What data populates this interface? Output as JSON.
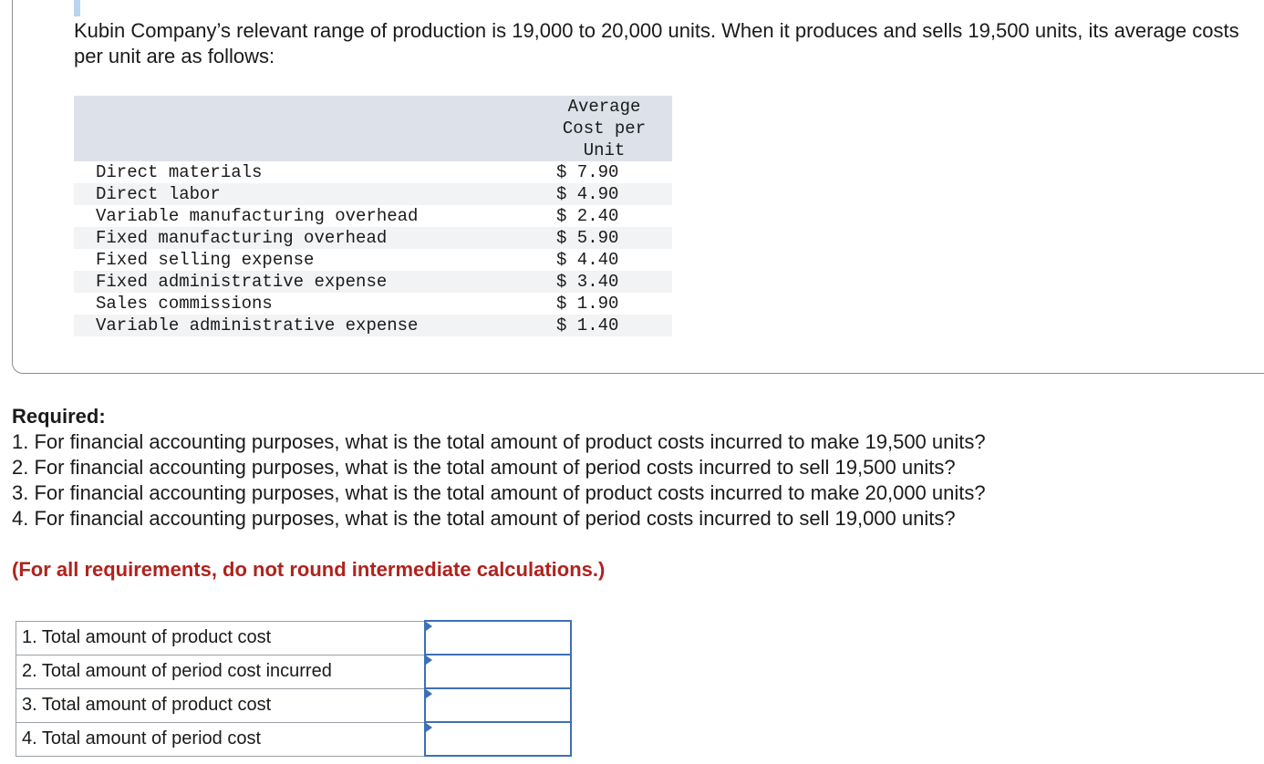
{
  "intro": "Kubin Company’s relevant range of production is 19,000 to 20,000 units. When it produces and sells 19,500 units, its average costs per unit are as follows:",
  "cost_table": {
    "header": [
      "Average",
      "Cost per",
      "Unit"
    ],
    "rows": [
      {
        "label": "Direct materials",
        "value": "$ 7.90"
      },
      {
        "label": "Direct labor",
        "value": "$ 4.90"
      },
      {
        "label": "Variable manufacturing overhead",
        "value": "$ 2.40"
      },
      {
        "label": "Fixed manufacturing overhead",
        "value": "$ 5.90"
      },
      {
        "label": "Fixed selling expense",
        "value": "$ 4.40"
      },
      {
        "label": "Fixed administrative expense",
        "value": "$ 3.40"
      },
      {
        "label": "Sales commissions",
        "value": "$ 1.90"
      },
      {
        "label": "Variable administrative expense",
        "value": "$ 1.40"
      }
    ]
  },
  "required": {
    "title": "Required:",
    "items": [
      "1. For financial accounting purposes, what is the total amount of product costs incurred to make 19,500 units?",
      "2. For financial accounting purposes, what is the total amount of period costs incurred to sell 19,500 units?",
      "3. For financial accounting purposes, what is the total amount of product costs incurred to make 20,000 units?",
      "4. For financial accounting purposes, what is the total amount of period costs incurred to sell 19,000 units?"
    ],
    "note": "(For all requirements, do not round intermediate calculations.)"
  },
  "answers": [
    {
      "label": "1. Total amount of product cost",
      "value": ""
    },
    {
      "label": "2. Total amount of period cost incurred",
      "value": ""
    },
    {
      "label": "3. Total amount of product cost",
      "value": ""
    },
    {
      "label": "4. Total amount of period cost",
      "value": ""
    }
  ],
  "colors": {
    "accent": "#3e6fb8",
    "note": "#b0221d",
    "table_header_bg": "#dde2ea"
  }
}
